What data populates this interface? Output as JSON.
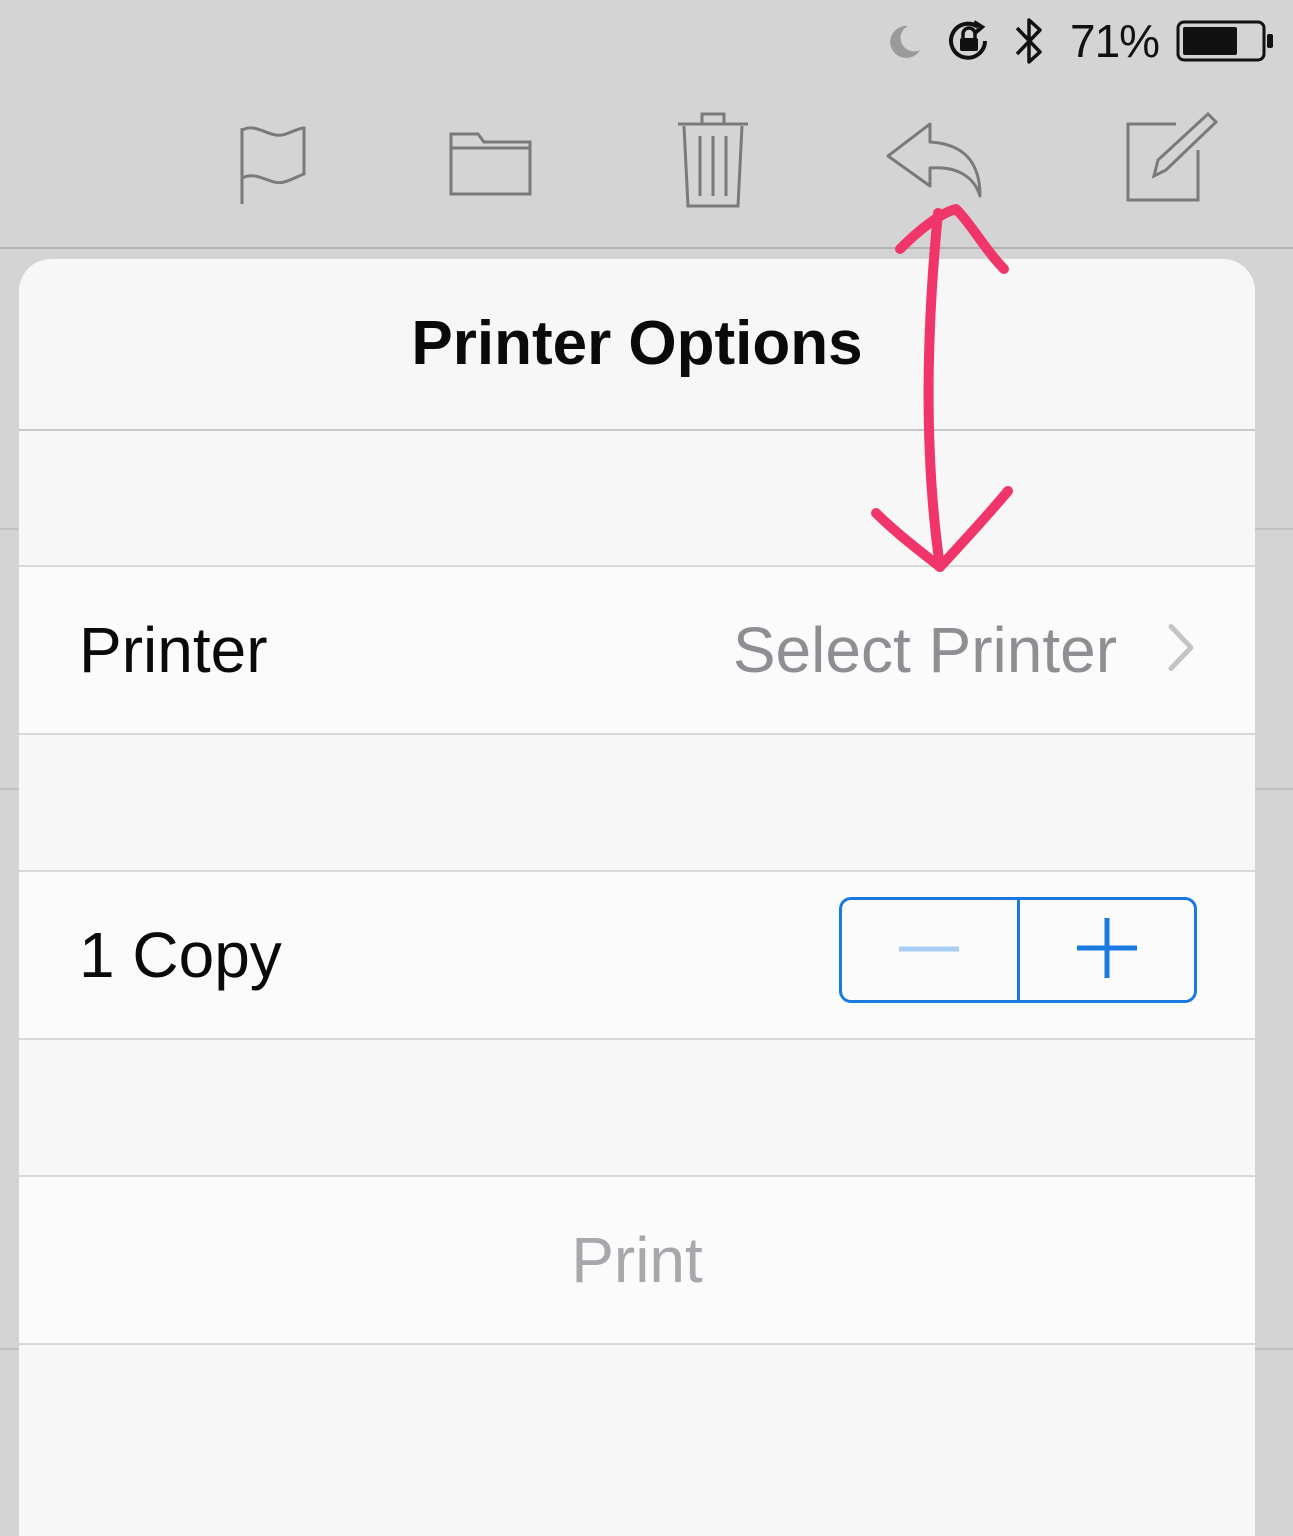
{
  "status_bar": {
    "battery_percent": "71%",
    "battery_level": 0.71,
    "icons": [
      "moon-icon",
      "rotation-lock-icon",
      "bluetooth-icon",
      "battery-icon"
    ]
  },
  "toolbar": {
    "icons": [
      "flag-icon",
      "folder-icon",
      "trash-icon",
      "reply-icon",
      "compose-icon"
    ]
  },
  "popover": {
    "title": "Printer Options",
    "printer_row": {
      "label": "Printer",
      "value": "Select Printer"
    },
    "copies_row": {
      "label": "1 Copy",
      "copies": 1
    },
    "print_button": "Print"
  },
  "colors": {
    "accent": "#1a7ae0",
    "annotation": "#f0356a",
    "secondary_text": "#8e8e93",
    "disabled_text": "#a8a8ac"
  }
}
